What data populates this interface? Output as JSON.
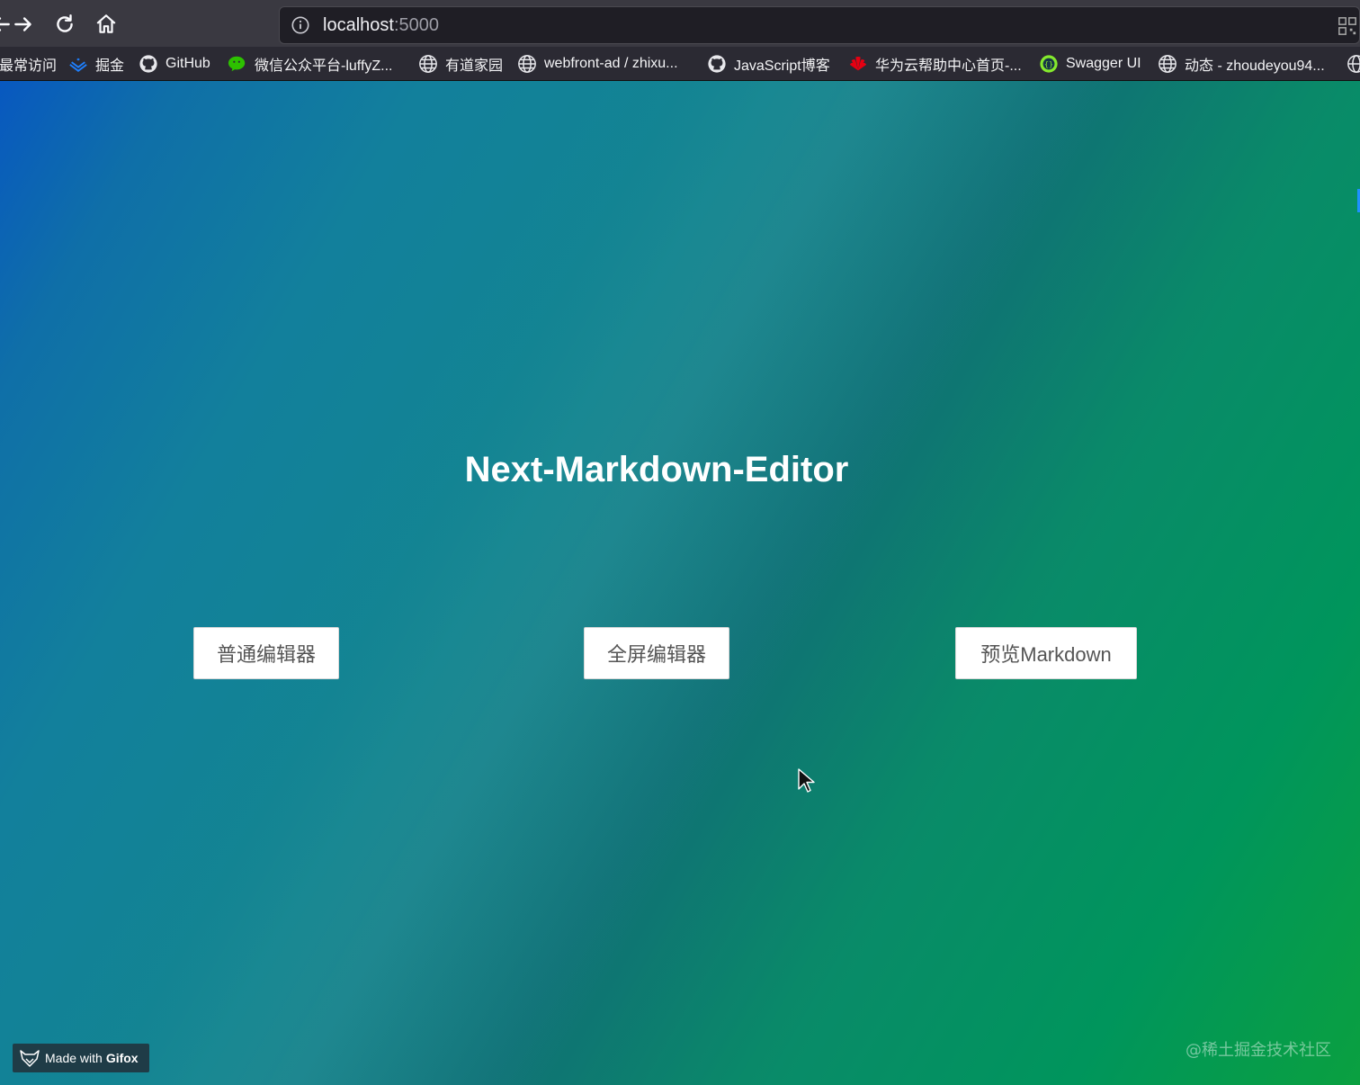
{
  "browser": {
    "url_host": "localhost",
    "url_port": ":5000",
    "bookmarks": [
      {
        "label": "最常访问",
        "icon": "none"
      },
      {
        "label": "掘金",
        "icon": "juejin-icon"
      },
      {
        "label": "GitHub",
        "icon": "github-icon"
      },
      {
        "label": "微信公众平台-luffyZ...",
        "icon": "wechat-icon"
      },
      {
        "label": "有道家园",
        "icon": "globe-icon"
      },
      {
        "label": "webfront-ad / zhixu...",
        "icon": "globe-icon"
      },
      {
        "label": "JavaScript博客",
        "icon": "github-icon"
      },
      {
        "label": "华为云帮助中心首页-...",
        "icon": "huawei-icon"
      },
      {
        "label": "Swagger UI",
        "icon": "swagger-icon"
      },
      {
        "label": "动态 - zhoudeyou94...",
        "icon": "globe-icon"
      }
    ]
  },
  "page": {
    "title": "Next-Markdown-Editor",
    "buttons": {
      "normal_editor": "普通编辑器",
      "fullscreen_editor": "全屏编辑器",
      "preview_markdown": "预览Markdown"
    }
  },
  "overlay": {
    "gifox_prefix": "Made with",
    "gifox_brand": "Gifox",
    "watermark": "@稀土掘金技术社区"
  },
  "colors": {
    "gradient_start": "#0858c0",
    "gradient_mid": "#138590",
    "gradient_end": "#0aa040"
  }
}
